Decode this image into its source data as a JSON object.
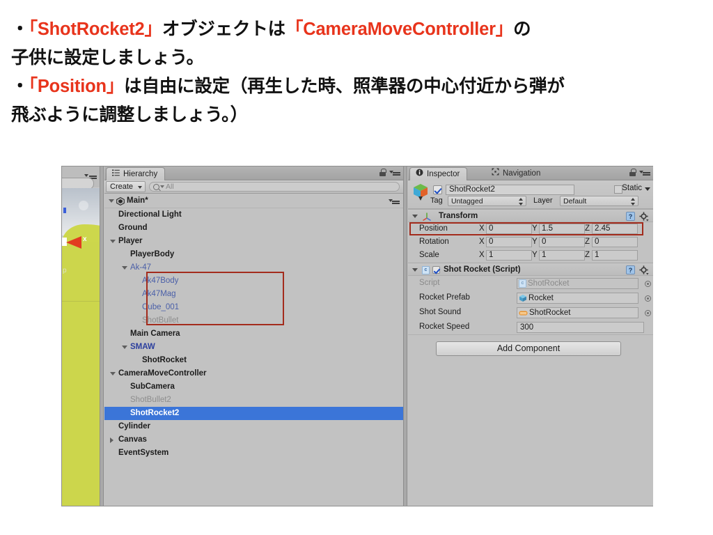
{
  "slide": {
    "lines": [
      [
        {
          "t": "・",
          "hl": false
        },
        {
          "t": "「ShotRocket2」",
          "hl": true
        },
        {
          "t": "オブジェクトは",
          "hl": false
        },
        {
          "t": "「CameraMoveController」",
          "hl": true
        },
        {
          "t": "の",
          "hl": false
        }
      ],
      [
        {
          "t": "子供に設定しましょう。",
          "hl": false
        }
      ],
      [
        {
          "t": "・",
          "hl": false
        },
        {
          "t": "「Position」",
          "hl": true
        },
        {
          "t": "は自由に設定（再生した時、照準器の中心付近から弾が",
          "hl": false
        }
      ],
      [
        {
          "t": "飛ぶように調整しましょう。）",
          "hl": false
        }
      ]
    ],
    "highlight_color": "#e8341c"
  },
  "unity": {
    "scene_view": {
      "gizmo_axis_label": "x"
    },
    "hierarchy": {
      "tab_label": "Hierarchy",
      "create_button": "Create",
      "search_placeholder": "All",
      "scene_name": "Main*",
      "selection_color": "#3b75d8",
      "annotation_color": "#a32b1c",
      "items": [
        {
          "label": "Directional Light",
          "indent": 1,
          "twirl": "none",
          "style": "dark",
          "selected": false
        },
        {
          "label": "Ground",
          "indent": 1,
          "twirl": "none",
          "style": "dark",
          "selected": false
        },
        {
          "label": "Player",
          "indent": 1,
          "twirl": "open",
          "style": "dark",
          "selected": false
        },
        {
          "label": "PlayerBody",
          "indent": 2,
          "twirl": "none",
          "style": "dark",
          "selected": false
        },
        {
          "label": "Ak-47",
          "indent": 2,
          "twirl": "open",
          "style": "blue",
          "selected": false
        },
        {
          "label": "Ak47Body",
          "indent": 3,
          "twirl": "none",
          "style": "blue",
          "selected": false
        },
        {
          "label": "Ak47Mag",
          "indent": 3,
          "twirl": "none",
          "style": "blue",
          "selected": false
        },
        {
          "label": "Cube_001",
          "indent": 3,
          "twirl": "none",
          "style": "blue",
          "selected": false
        },
        {
          "label": "ShotBullet",
          "indent": 3,
          "twirl": "none",
          "style": "gray",
          "selected": false
        },
        {
          "label": "Main Camera",
          "indent": 2,
          "twirl": "none",
          "style": "dark",
          "selected": false
        },
        {
          "label": "SMAW",
          "indent": 2,
          "twirl": "open",
          "style": "blue-strong",
          "selected": false
        },
        {
          "label": "ShotRocket",
          "indent": 3,
          "twirl": "none",
          "style": "dark",
          "selected": false
        },
        {
          "label": "CameraMoveController",
          "indent": 1,
          "twirl": "open",
          "style": "dark",
          "selected": false
        },
        {
          "label": "SubCamera",
          "indent": 2,
          "twirl": "none",
          "style": "dark",
          "selected": false
        },
        {
          "label": "ShotBullet2",
          "indent": 2,
          "twirl": "none",
          "style": "gray",
          "selected": false
        },
        {
          "label": "ShotRocket2",
          "indent": 2,
          "twirl": "none",
          "style": "dark",
          "selected": true
        },
        {
          "label": "Cylinder",
          "indent": 1,
          "twirl": "none",
          "style": "dark",
          "selected": false
        },
        {
          "label": "Canvas",
          "indent": 1,
          "twirl": "closed",
          "style": "dark",
          "selected": false
        },
        {
          "label": "EventSystem",
          "indent": 1,
          "twirl": "none",
          "style": "dark",
          "selected": false
        }
      ]
    },
    "inspector": {
      "tab_label": "Inspector",
      "navigation_tab_label": "Navigation",
      "object_name": "ShotRocket2",
      "static_label": "Static",
      "tag_label": "Tag",
      "tag_value": "Untagged",
      "layer_label": "Layer",
      "layer_value": "Default",
      "transform": {
        "title": "Transform",
        "rows": [
          {
            "name": "Position",
            "x": "0",
            "y": "1.5",
            "z": "2.45",
            "highlighted": true
          },
          {
            "name": "Rotation",
            "x": "0",
            "y": "0",
            "z": "0",
            "highlighted": false
          },
          {
            "name": "Scale",
            "x": "1",
            "y": "1",
            "z": "1",
            "highlighted": false
          }
        ],
        "axis_labels": [
          "X",
          "Y",
          "Z"
        ]
      },
      "script_component": {
        "title": "Shot Rocket (Script)",
        "rows": [
          {
            "name": "Script",
            "value": "ShotRocket",
            "icon": "csharp-script-icon",
            "dim": true,
            "type": "object"
          },
          {
            "name": "Rocket Prefab",
            "value": "Rocket",
            "icon": "prefab-cube-icon",
            "dim": false,
            "type": "object"
          },
          {
            "name": "Shot Sound",
            "value": "ShotRocket",
            "icon": "audio-clip-icon",
            "dim": false,
            "type": "object"
          },
          {
            "name": "Rocket Speed",
            "value": "300",
            "icon": "",
            "dim": false,
            "type": "number"
          }
        ]
      },
      "add_component_label": "Add Component"
    }
  }
}
